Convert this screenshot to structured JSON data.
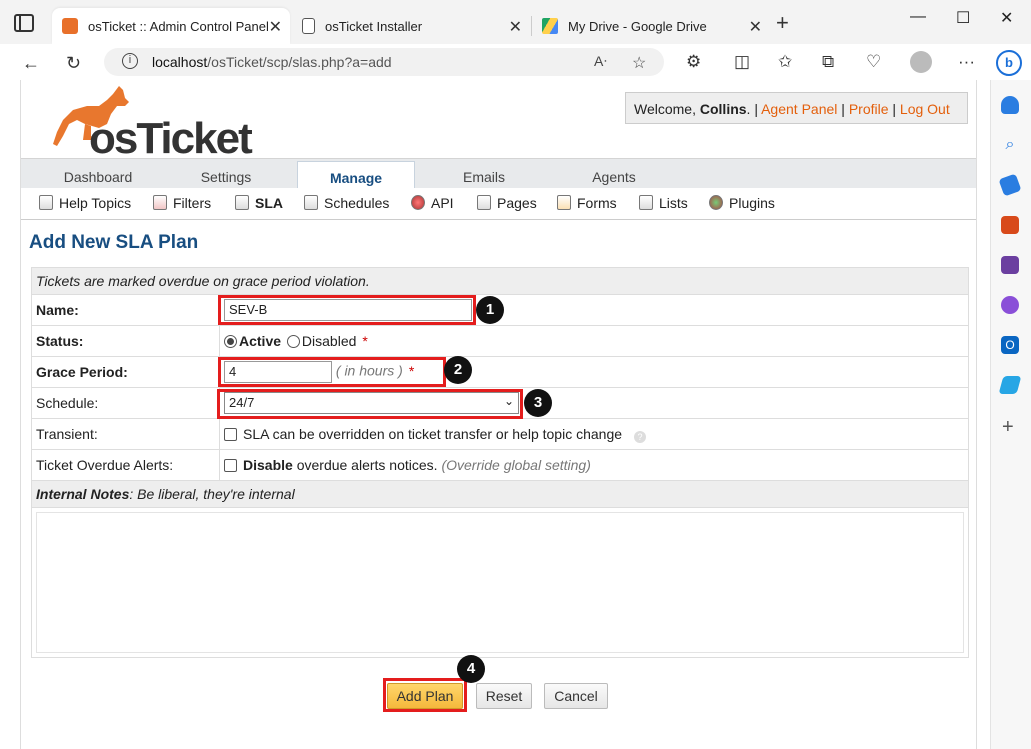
{
  "browser": {
    "tabs": [
      {
        "title": "osTicket :: Admin Control Panel",
        "active": true
      },
      {
        "title": "osTicket Installer",
        "active": false
      },
      {
        "title": "My Drive - Google Drive",
        "active": false
      }
    ],
    "url_host": "localhost",
    "url_path": "/osTicket/scp/slas.php?a=add"
  },
  "header": {
    "logo_text": "osTicket",
    "welcome": "Welcome, ",
    "user": "Collins",
    "links": [
      "Agent Panel",
      "Profile",
      "Log Out"
    ],
    "sep": " | "
  },
  "main_nav": [
    "Dashboard",
    "Settings",
    "Manage",
    "Emails",
    "Agents"
  ],
  "active_main_nav": "Manage",
  "sub_nav": [
    "Help Topics",
    "Filters",
    "SLA",
    "Schedules",
    "API",
    "Pages",
    "Forms",
    "Lists",
    "Plugins"
  ],
  "active_sub_nav": "SLA",
  "page_title": "Add New SLA Plan",
  "form": {
    "header_note": "Tickets are marked overdue on grace period violation.",
    "name_label": "Name:",
    "name_value": "SEV-B",
    "status_label": "Status:",
    "status_active": "Active",
    "status_disabled": "Disabled",
    "status_selected": "Active",
    "required_mark": "*",
    "grace_label": "Grace Period:",
    "grace_value": "4",
    "grace_hint": "( in hours )",
    "schedule_label": "Schedule:",
    "schedule_value": "24/7",
    "transient_label": "Transient:",
    "transient_text": "SLA can be overridden on ticket transfer or help topic change",
    "alerts_label": "Ticket Overdue Alerts:",
    "alerts_bold": "Disable",
    "alerts_text": "overdue alerts notices.",
    "alerts_hint": "(Override global setting)",
    "notes_title": "Internal Notes",
    "notes_hint": ": Be liberal, they're internal"
  },
  "buttons": {
    "add": "Add Plan",
    "reset": "Reset",
    "cancel": "Cancel"
  },
  "annotations": [
    "1",
    "2",
    "3",
    "4"
  ],
  "colors": {
    "brand_orange": "#e35f0c",
    "title_blue": "#184e81",
    "highlight_red": "#e41d1d"
  }
}
